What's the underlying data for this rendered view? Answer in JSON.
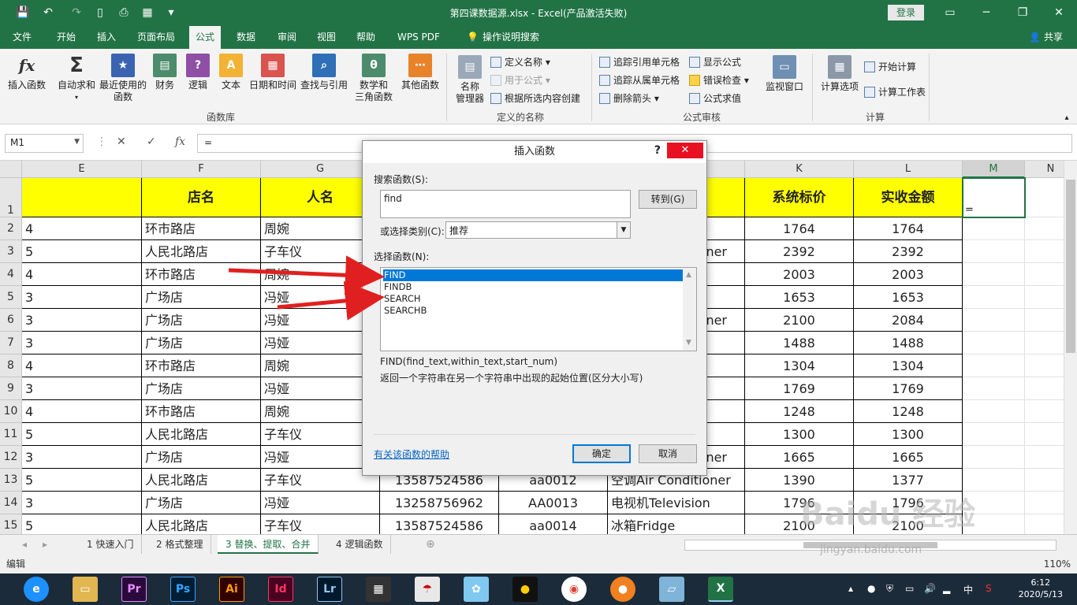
{
  "titlebar": {
    "title": "第四课数据源.xlsx  -  Excel(产品激活失败)",
    "login": "登录",
    "win_min": "─",
    "win_restore": "❐",
    "win_close": "✕"
  },
  "tabs": [
    "文件",
    "开始",
    "插入",
    "页面布局",
    "公式",
    "数据",
    "审阅",
    "视图",
    "帮助",
    "WPS PDF",
    "操作说明搜索"
  ],
  "share": "共享",
  "ribbon": {
    "insert_function": "插入函数",
    "autosum": [
      "自动求和"
    ],
    "recent": [
      "最近使用的",
      "函数"
    ],
    "finance": "财务",
    "logic": "逻辑",
    "text": "文本",
    "datetime": "日期和时间",
    "lookup": "查找与引用",
    "math": [
      "数学和",
      "三角函数"
    ],
    "other": "其他函数",
    "group_funclib": "函数库",
    "name_manager": [
      "名称",
      "管理器"
    ],
    "define_name": "定义名称",
    "use_in_formula": "用于公式",
    "create_from_selection": "根据所选内容创建",
    "group_defined_names": "定义的名称",
    "trace_precedents": "追踪引用单元格",
    "trace_dependents": "追踪从属单元格",
    "remove_arrows": "删除箭头",
    "show_formulas": "显示公式",
    "error_check": "错误检查",
    "evaluate_formula": "公式求值",
    "watch_window": "监视窗口",
    "group_auditing": "公式审核",
    "calc_options": "计算选项",
    "calc_now": "开始计算",
    "calc_sheet": "计算工作表",
    "group_calc": "计算"
  },
  "formula_bar": {
    "namebox": "M1",
    "cancel": "✕",
    "enter": "✓",
    "fx": "fx",
    "formula": "="
  },
  "columns": [
    "E",
    "F",
    "G",
    "K",
    "L",
    "M",
    "N"
  ],
  "header_row": {
    "F": "店名",
    "G": "人名",
    "K": "系统标价",
    "L": "实收金额"
  },
  "rows": [
    {
      "num": "1"
    },
    {
      "num": "2",
      "E": "4",
      "F": "环市路店",
      "G": "周婉",
      "K": "1764",
      "L": "1764"
    },
    {
      "num": "3",
      "E": "5",
      "F": "人民北路店",
      "G": "子车仪",
      "Jtail": "ner",
      "K": "2392",
      "L": "2392"
    },
    {
      "num": "4",
      "E": "4",
      "F": "环市路店",
      "G": "周婉",
      "K": "2003",
      "L": "2003"
    },
    {
      "num": "5",
      "E": "3",
      "F": "广场店",
      "G": "冯娅",
      "K": "1653",
      "L": "1653"
    },
    {
      "num": "6",
      "E": "3",
      "F": "广场店",
      "G": "冯娅",
      "Jtail": "ner",
      "K": "2100",
      "L": "2084"
    },
    {
      "num": "7",
      "E": "3",
      "F": "广场店",
      "G": "冯娅",
      "K": "1488",
      "L": "1488"
    },
    {
      "num": "8",
      "E": "4",
      "F": "环市路店",
      "G": "周婉",
      "K": "1304",
      "L": "1304"
    },
    {
      "num": "9",
      "E": "3",
      "F": "广场店",
      "G": "冯娅",
      "K": "1769",
      "L": "1769"
    },
    {
      "num": "10",
      "E": "4",
      "F": "环市路店",
      "G": "周婉",
      "K": "1248",
      "L": "1248"
    },
    {
      "num": "11",
      "E": "5",
      "F": "人民北路店",
      "G": "子车仪",
      "K": "1300",
      "L": "1300"
    },
    {
      "num": "12",
      "E": "3",
      "F": "广场店",
      "G": "冯娅",
      "Jtail": "ner",
      "K": "1665",
      "L": "1665"
    },
    {
      "num": "13",
      "E": "5",
      "F": "人民北路店",
      "G": "子车仪",
      "H": "13587524586",
      "I": "aa0012",
      "J": "空调Air Conditioner",
      "K": "1390",
      "L": "1377"
    },
    {
      "num": "14",
      "E": "3",
      "F": "广场店",
      "G": "冯娅",
      "H": "13258756962",
      "I": "AA0013",
      "J": "电视机Television",
      "K": "1796",
      "L": "1796"
    },
    {
      "num": "15",
      "E": "5",
      "F": "人民北路店",
      "G": "子车仪",
      "H": "13587524586",
      "I": "aa0014",
      "J": "冰箱Fridge",
      "K": "2100",
      "L": "2100"
    }
  ],
  "active_cell_value": "=",
  "sheets": [
    "1 快速入门",
    "2 格式整理",
    "3 替换、提取、合并",
    "4 逻辑函数"
  ],
  "status": {
    "mode": "编辑",
    "zoom": "110%"
  },
  "dialog": {
    "title": "插入函数",
    "help": "?",
    "close": "✕",
    "search_label": "搜索函数(S):",
    "search_value": "find",
    "goto": "转到(G)",
    "category_label": "或选择类别(C):",
    "category_value": "推荐",
    "select_label": "选择函数(N):",
    "functions": [
      "FIND",
      "FINDB",
      "SEARCH",
      "SEARCHB"
    ],
    "syntax": "FIND(find_text,within_text,start_num)",
    "description": "返回一个字符串在另一个字符串中出现的起始位置(区分大小写)",
    "help_link": "有关该函数的帮助",
    "ok": "确定",
    "cancel": "取消"
  },
  "taskbar": {
    "apps": [
      "Pr",
      "Ps",
      "Ai",
      "Id",
      "Lr"
    ],
    "time": "6:12",
    "date": "2020/5/13",
    "ime": "中"
  },
  "watermark": {
    "brand": "Baidu 经验",
    "url": "jingyan.baidu.com"
  },
  "colors": {
    "excel_green": "#217346",
    "header_yellow": "#ffff00",
    "arrow_red": "#e02020",
    "select_blue": "#0078d7"
  }
}
